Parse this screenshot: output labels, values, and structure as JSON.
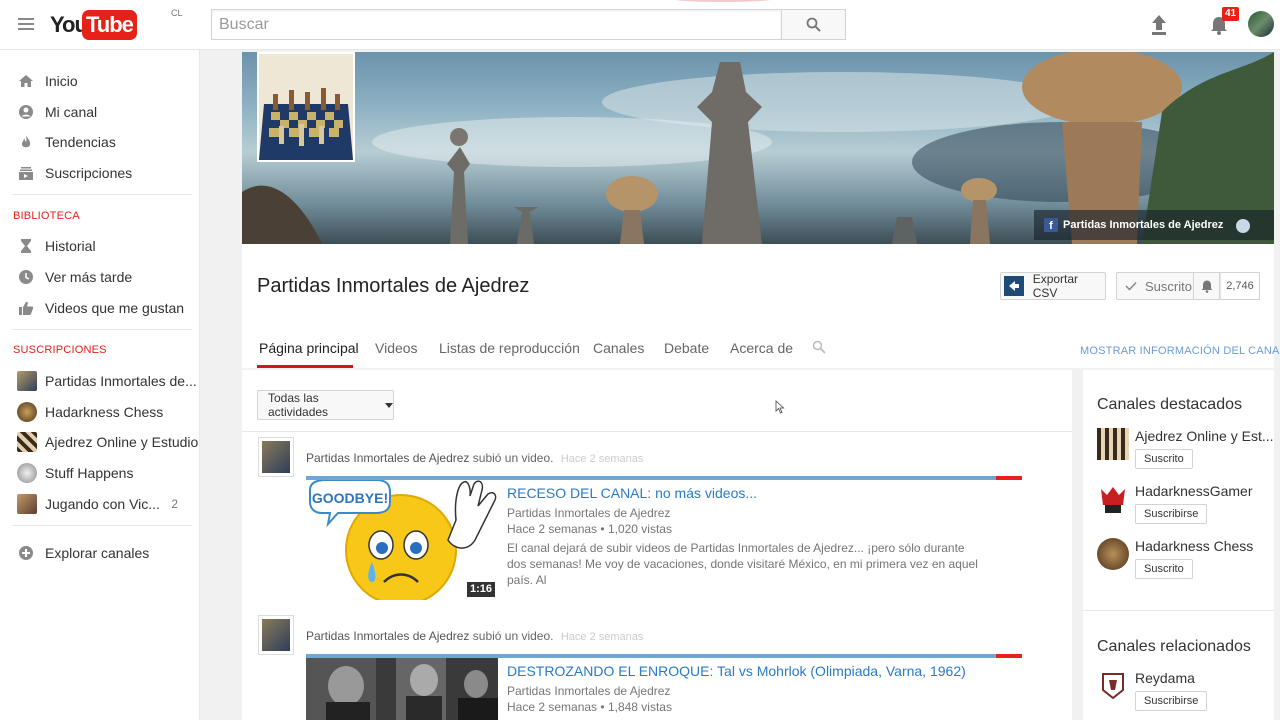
{
  "header": {
    "logo_you": "You",
    "logo_tube": "Tube",
    "region": "CL",
    "search_placeholder": "Buscar",
    "notification_count": "41",
    "brand_color": "#e62117"
  },
  "sidebar": {
    "main": [
      {
        "label": "Inicio",
        "icon": "home-icon"
      },
      {
        "label": "Mi canal",
        "icon": "user-circle-icon"
      },
      {
        "label": "Tendencias",
        "icon": "flame-icon"
      },
      {
        "label": "Suscripciones",
        "icon": "subscriptions-icon"
      }
    ],
    "library_title": "BIBLIOTECA",
    "library": [
      {
        "label": "Historial",
        "icon": "hourglass-icon"
      },
      {
        "label": "Ver más tarde",
        "icon": "clock-icon"
      },
      {
        "label": "Videos que me gustan",
        "icon": "thumbs-up-icon"
      }
    ],
    "subs_title": "SUSCRIPCIONES",
    "subscriptions": [
      {
        "label": "Partidas Inmortales de...",
        "count": ""
      },
      {
        "label": "Hadarkness Chess",
        "count": ""
      },
      {
        "label": "Ajedrez Online y Estudio",
        "count": ""
      },
      {
        "label": "Stuff Happens",
        "count": ""
      },
      {
        "label": "Jugando con Vic...",
        "count": "2"
      }
    ],
    "explore": "Explorar canales"
  },
  "channel": {
    "name": "Partidas Inmortales de Ajedrez",
    "facebook_label": "Partidas Inmortales de Ajedrez",
    "export_label": "Exportar CSV",
    "subscribed_label": "Suscrito",
    "subscriber_count": "2,746",
    "tabs": [
      "Página principal",
      "Videos",
      "Listas de reproducción",
      "Canales",
      "Debate",
      "Acerca de"
    ],
    "show_info": "MOSTRAR INFORMACIÓN DEL CANAL"
  },
  "feed": {
    "filter_label": "Todas las actividades",
    "items": [
      {
        "channel": "Partidas Inmortales de Ajedrez",
        "action": "subió un video.",
        "time": "Hace 2 semanas",
        "title": "RECESO DEL CANAL: no más videos...",
        "byline": "Partidas Inmortales de Ajedrez",
        "meta_age": "Hace 2 semanas",
        "meta_views": "1,020 vistas",
        "duration": "1:16",
        "thumb_text": "GOODBYE!",
        "desc": "El canal dejará de subir videos de Partidas Inmortales de Ajedrez... ¡pero sólo durante dos semanas! Me voy de vacaciones, donde visitaré México, en mi primera vez en aquel país. Al"
      },
      {
        "channel": "Partidas Inmortales de Ajedrez",
        "action": "subió un video.",
        "time": "Hace 2 semanas",
        "title": "DESTROZANDO EL ENROQUE: Tal vs Mohrlok (Olimpiada, Varna, 1962)",
        "byline": "Partidas Inmortales de Ajedrez",
        "meta_age": "Hace 2 semanas",
        "meta_views": "1,848 vistas"
      }
    ]
  },
  "right": {
    "featured_title": "Canales destacados",
    "featured": [
      {
        "name": "Ajedrez Online y Est...",
        "button": "Suscrito"
      },
      {
        "name": "HadarknessGamer",
        "button": "Suscribirse"
      },
      {
        "name": "Hadarkness Chess",
        "button": "Suscrito"
      }
    ],
    "related_title": "Canales relacionados",
    "related": [
      {
        "name": "Reydama",
        "button": "Suscribirse"
      }
    ]
  }
}
